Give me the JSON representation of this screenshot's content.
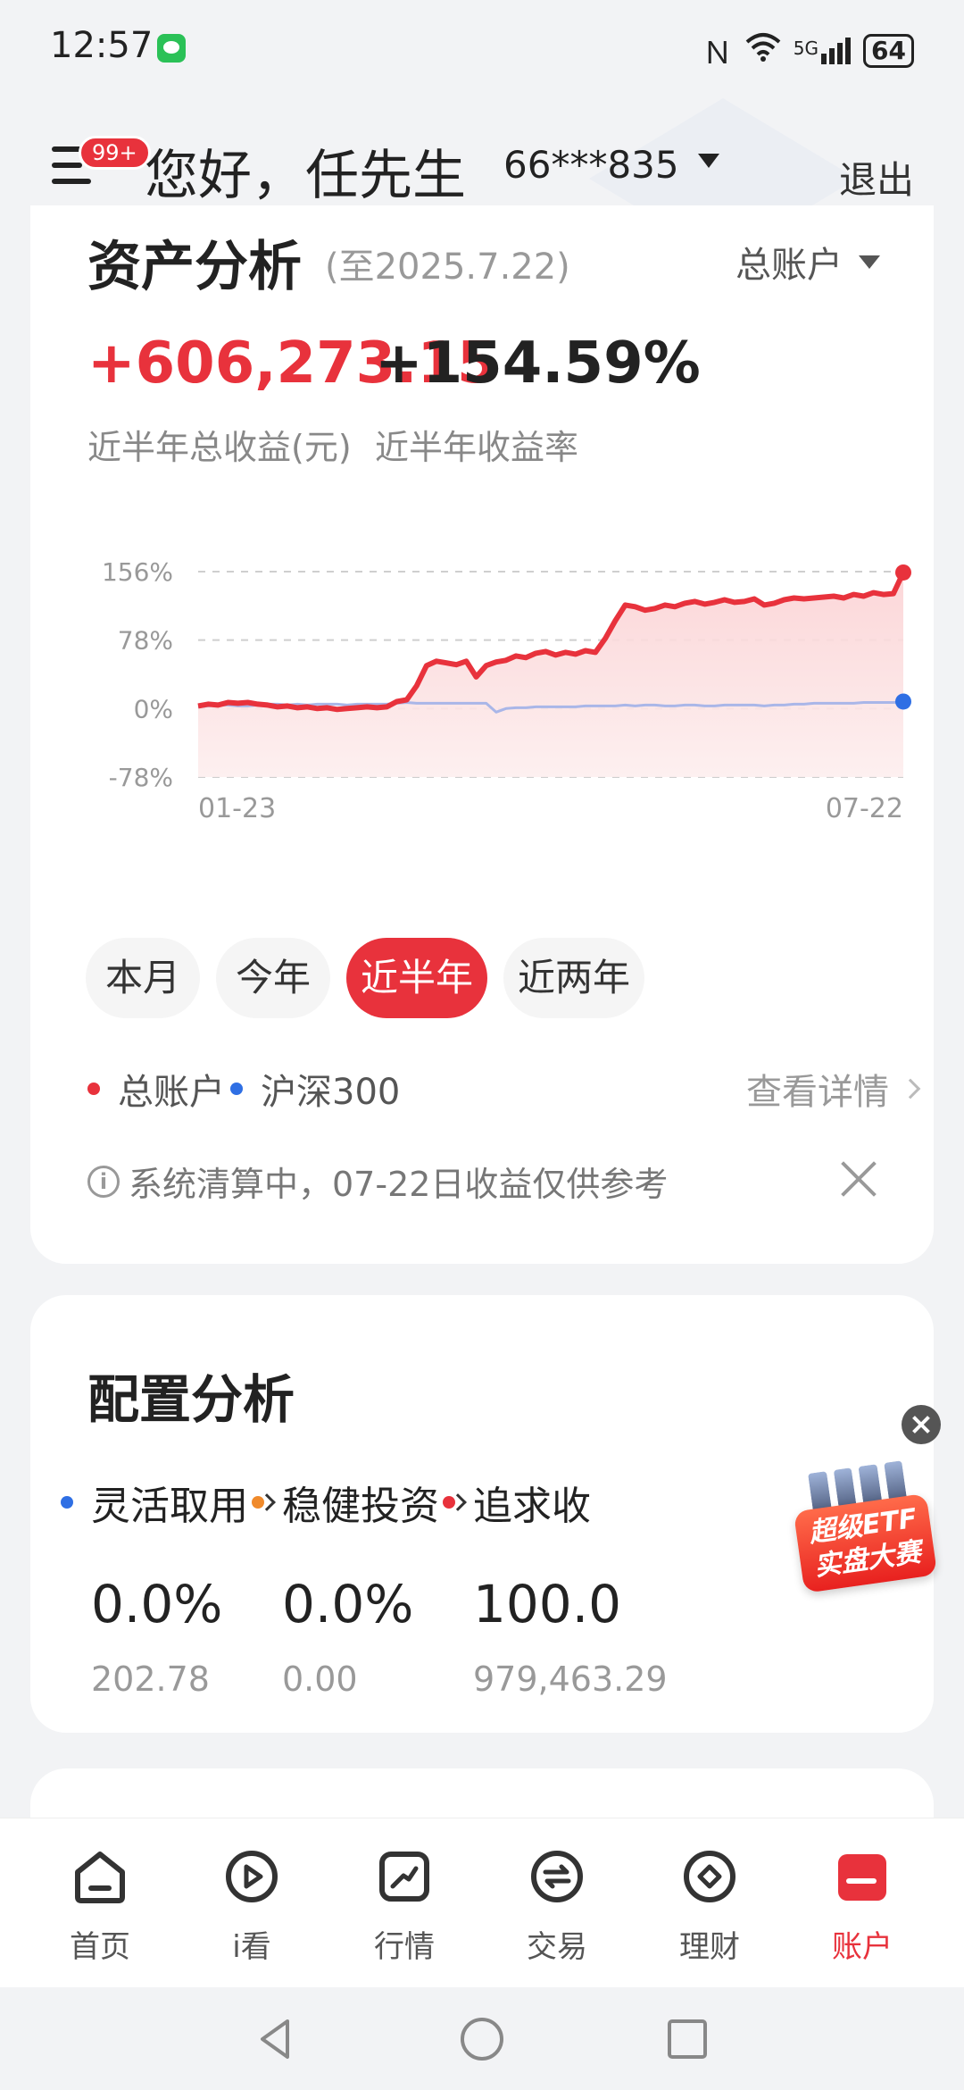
{
  "status_bar": {
    "time": "12:57",
    "network": "5G",
    "battery": "64"
  },
  "header": {
    "badge": "99+",
    "greeting": "您好，任先生",
    "account": "66***835",
    "logout": "退出"
  },
  "asset_analysis": {
    "title": "资产分析",
    "date": "(至2025.7.22)",
    "account_selector": "总账户",
    "total_profit": "+606,273.15",
    "total_profit_label": "近半年总收益(元)",
    "return_rate": "+154.59%",
    "return_rate_label": "近半年收益率",
    "periods": [
      "本月",
      "今年",
      "近半年",
      "近两年"
    ],
    "active_period": "近半年",
    "legend": {
      "series1": "总账户",
      "series2": "沪深300",
      "detail": "查看详情"
    },
    "notice": "系统清算中，07-22日收益仅供参考",
    "colors": {
      "red": "#e8323c",
      "blue": "#2f6fe4"
    }
  },
  "chart_data": {
    "type": "area",
    "x_tick_labels": [
      "01-23",
      "07-22"
    ],
    "y_tick_labels": [
      "156%",
      "78%",
      "0%",
      "-78%"
    ],
    "ylim": [
      -78,
      156
    ],
    "grid": true,
    "series": [
      {
        "name": "总账户",
        "color": "#e8323c",
        "values": [
          3,
          5,
          4,
          7,
          6,
          7,
          5,
          4,
          2,
          3,
          1,
          2,
          0,
          1,
          -1,
          0,
          1,
          2,
          1,
          2,
          8,
          10,
          26,
          49,
          54,
          52,
          50,
          54,
          36,
          49,
          53,
          55,
          60,
          58,
          63,
          65,
          61,
          64,
          62,
          66,
          64,
          80,
          100,
          118,
          116,
          112,
          114,
          118,
          116,
          120,
          122,
          119,
          121,
          124,
          121,
          122,
          125,
          118,
          120,
          124,
          126,
          125,
          126,
          127,
          128,
          126,
          130,
          128,
          132,
          130,
          131,
          155
        ]
      },
      {
        "name": "沪深300",
        "color": "#a9b6e8",
        "values": [
          2,
          3,
          4,
          4,
          3,
          3,
          4,
          5,
          5,
          4,
          5,
          4,
          5,
          5,
          5,
          4,
          5,
          5,
          5,
          5,
          6,
          7,
          6,
          6,
          6,
          6,
          6,
          6,
          6,
          6,
          -4,
          0,
          1,
          1,
          2,
          2,
          2,
          2,
          2,
          3,
          3,
          3,
          3,
          4,
          3,
          4,
          4,
          3,
          3,
          4,
          4,
          3,
          3,
          4,
          4,
          4,
          4,
          3,
          4,
          4,
          5,
          5,
          6,
          6,
          6,
          6,
          6,
          7,
          7,
          7,
          7,
          8
        ]
      }
    ]
  },
  "allocation": {
    "title": "配置分析",
    "items": [
      {
        "name": "灵活取用",
        "pct": "0.0%",
        "amount": "202.78",
        "color": "#2f6fe4"
      },
      {
        "name": "稳健投资",
        "pct": "0.0%",
        "amount": "0.00",
        "color": "#f08a2b"
      },
      {
        "name": "追求收",
        "pct": "100.0",
        "amount": "979,463.29",
        "color": "#e8323c"
      }
    ]
  },
  "ad": {
    "line1": "超级ETF",
    "line2": "实盘大赛"
  },
  "bottom_nav": {
    "items": [
      "首页",
      "i看",
      "行情",
      "交易",
      "理财",
      "账户"
    ],
    "active": "账户"
  }
}
